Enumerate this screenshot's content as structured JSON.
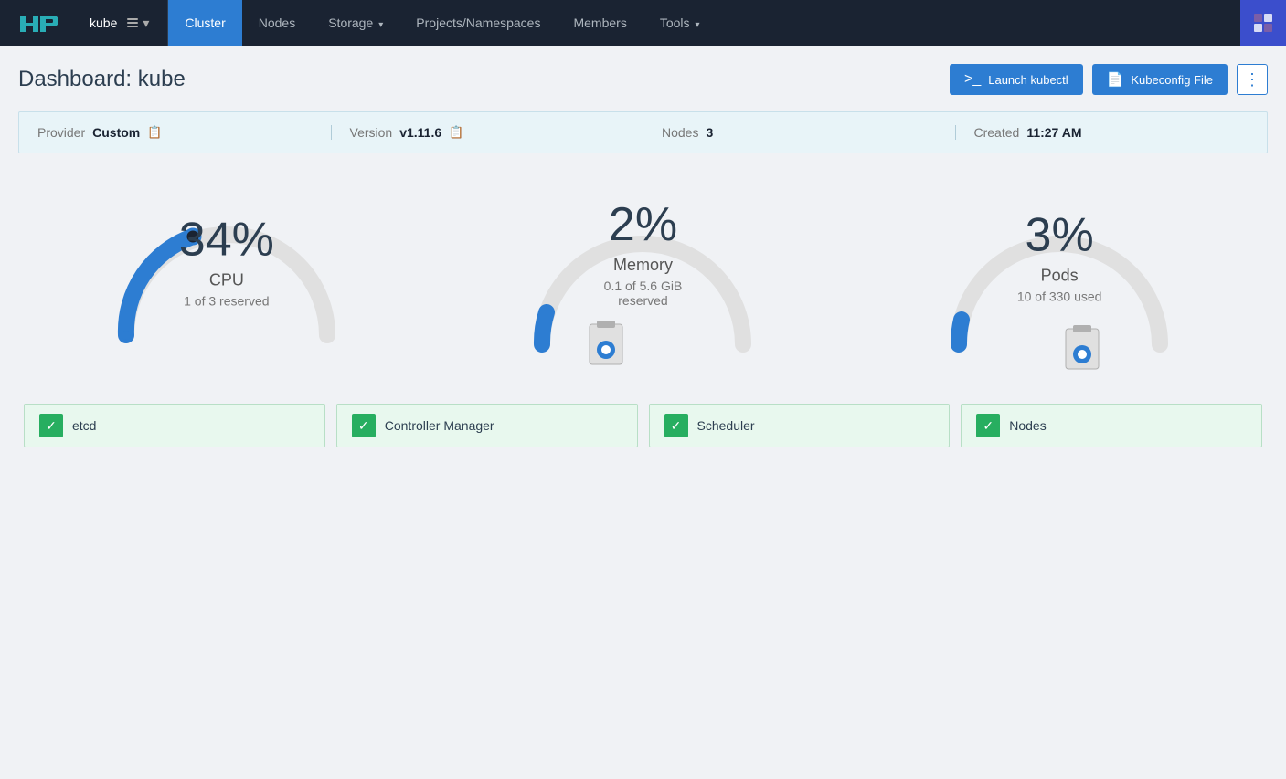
{
  "navbar": {
    "brand": "kube",
    "cluster_selector": "kube",
    "nav_items": [
      {
        "label": "Cluster",
        "active": true,
        "dropdown": false
      },
      {
        "label": "Nodes",
        "active": false,
        "dropdown": false
      },
      {
        "label": "Storage",
        "active": false,
        "dropdown": true
      },
      {
        "label": "Projects/Namespaces",
        "active": false,
        "dropdown": false
      },
      {
        "label": "Members",
        "active": false,
        "dropdown": false
      },
      {
        "label": "Tools",
        "active": false,
        "dropdown": true
      }
    ]
  },
  "page": {
    "title": "Dashboard: kube",
    "launch_kubectl_label": "Launch kubectl",
    "kubeconfig_label": "Kubeconfig File",
    "more_button": "⋮"
  },
  "info_bar": {
    "provider_label": "Provider",
    "provider_value": "Custom",
    "version_label": "Version",
    "version_value": "v1.11.6",
    "nodes_label": "Nodes",
    "nodes_value": "3",
    "created_label": "Created",
    "created_value": "11:27 AM"
  },
  "gauges": [
    {
      "id": "cpu",
      "percent": "34%",
      "label": "CPU",
      "sub": "1 of 3 reserved",
      "value": 34,
      "color": "#2d7dd2",
      "track_color": "#e0e0e0"
    },
    {
      "id": "memory",
      "percent": "2%",
      "label": "Memory",
      "sub": "0.1 of 5.6 GiB reserved",
      "value": 2,
      "color": "#2d7dd2",
      "track_color": "#e0e0e0"
    },
    {
      "id": "pods",
      "percent": "3%",
      "label": "Pods",
      "sub": "10 of 330 used",
      "value": 3,
      "color": "#2d7dd2",
      "track_color": "#e0e0e0"
    }
  ],
  "status_items": [
    {
      "id": "etcd",
      "label": "etcd",
      "status": "ok"
    },
    {
      "id": "controller-manager",
      "label": "Controller Manager",
      "status": "ok"
    },
    {
      "id": "scheduler",
      "label": "Scheduler",
      "status": "ok"
    },
    {
      "id": "nodes",
      "label": "Nodes",
      "status": "ok"
    }
  ]
}
